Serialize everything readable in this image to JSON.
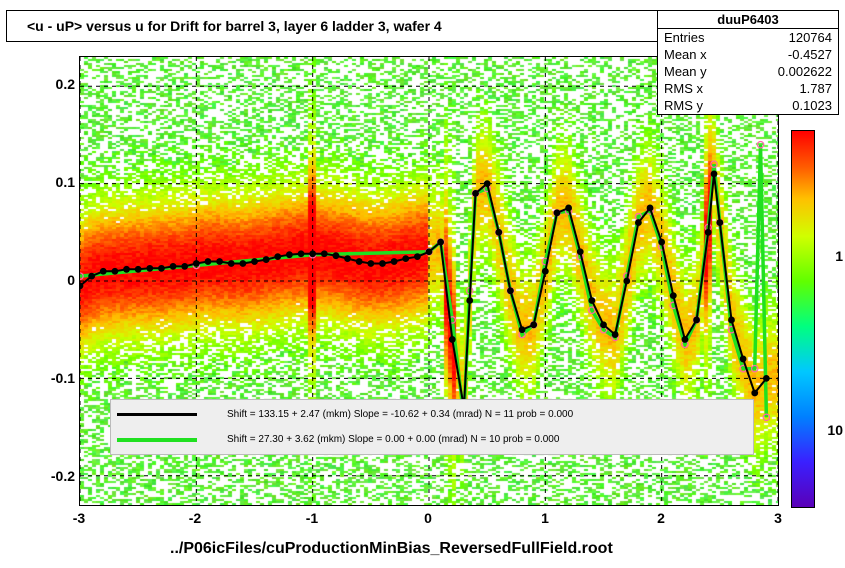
{
  "title": "<u - uP>       versus    u for Drift for barrel 3, layer 6 ladder 3, wafer 4",
  "stats": {
    "name": "duuP6403",
    "entries_label": "Entries",
    "entries": "120764",
    "meanx_label": "Mean x",
    "meanx": "-0.4527",
    "meany_label": "Mean y",
    "meany": "0.002622",
    "rmsx_label": "RMS x",
    "rmsx": "1.787",
    "rmsy_label": "RMS y",
    "rmsy": "0.1023"
  },
  "axes": {
    "x_ticks": [
      "-3",
      "-2",
      "-1",
      "0",
      "1",
      "2",
      "3"
    ],
    "y_ticks": [
      "-0.2",
      "-0.1",
      "0",
      "0.1",
      "0.2"
    ],
    "xlim": [
      -3,
      3
    ],
    "ylim": [
      -0.23,
      0.23
    ]
  },
  "colorbar": {
    "ticks": [
      "10",
      "1"
    ],
    "tick_positions": [
      0.88,
      0.35
    ]
  },
  "legend": {
    "fit1": "Shift =   133.15 +  2.47 (mkm) Slope =   -10.62 +  0.34 (mrad)  N = 11 prob = 0.000",
    "fit2": "Shift =    27.30 +  3.62 (mkm) Slope =     0.00 +  0.00 (mrad)  N = 10 prob = 0.000"
  },
  "caption": "../P06icFiles/cuProductionMinBias_ReversedFullField.root",
  "chart_data": {
    "type": "heatmap",
    "title": "<u - uP> versus u for Drift for barrel 3, layer 6 ladder 3, wafer 4",
    "xlabel": "u",
    "ylabel": "<u - uP>",
    "xlim": [
      -3,
      3
    ],
    "ylim": [
      -0.23,
      0.23
    ],
    "zscale": "log",
    "series": [
      {
        "name": "black profile (fit 1)",
        "type": "line+marker",
        "color": "#000000",
        "x": [
          -3.0,
          -2.9,
          -2.8,
          -2.7,
          -2.6,
          -2.5,
          -2.4,
          -2.3,
          -2.2,
          -2.1,
          -2.0,
          -1.9,
          -1.8,
          -1.7,
          -1.6,
          -1.5,
          -1.4,
          -1.3,
          -1.2,
          -1.1,
          -1.0,
          -0.9,
          -0.8,
          -0.7,
          -0.6,
          -0.5,
          -0.4,
          -0.3,
          -0.2,
          -0.1,
          0.0,
          0.1,
          0.2,
          0.3,
          0.35,
          0.4,
          0.5,
          0.6,
          0.7,
          0.8,
          0.9,
          1.0,
          1.1,
          1.2,
          1.3,
          1.4,
          1.5,
          1.6,
          1.7,
          1.8,
          1.9,
          2.0,
          2.1,
          2.2,
          2.3,
          2.4,
          2.45,
          2.5,
          2.6,
          2.7,
          2.8,
          2.9
        ],
        "y": [
          -0.005,
          0.005,
          0.01,
          0.01,
          0.012,
          0.012,
          0.013,
          0.013,
          0.015,
          0.015,
          0.018,
          0.02,
          0.02,
          0.018,
          0.018,
          0.02,
          0.022,
          0.025,
          0.027,
          0.028,
          0.028,
          0.028,
          0.026,
          0.023,
          0.02,
          0.018,
          0.018,
          0.02,
          0.023,
          0.025,
          0.03,
          0.04,
          -0.06,
          -0.13,
          -0.02,
          0.09,
          0.1,
          0.05,
          -0.01,
          -0.05,
          -0.045,
          0.01,
          0.07,
          0.075,
          0.03,
          -0.02,
          -0.045,
          -0.055,
          0.0,
          0.06,
          0.075,
          0.04,
          -0.015,
          -0.06,
          -0.04,
          0.05,
          0.11,
          0.06,
          -0.04,
          -0.08,
          -0.115,
          -0.1
        ]
      },
      {
        "name": "green fit (fit 2)",
        "type": "line",
        "color": "#20e020",
        "x": [
          -3.0,
          -2.0,
          -1.0,
          0.0,
          0.1,
          0.2,
          0.3,
          0.35,
          0.4,
          0.5,
          0.6,
          0.7,
          0.8,
          0.9,
          1.0,
          1.1,
          1.2,
          1.3,
          1.4,
          1.5,
          1.6,
          1.7,
          1.8,
          1.9,
          2.0,
          2.1,
          2.2,
          2.3,
          2.4,
          2.45,
          2.5,
          2.6,
          2.7,
          2.8,
          2.85,
          2.9
        ],
        "y": [
          0.005,
          0.016,
          0.027,
          0.03,
          0.04,
          -0.04,
          -0.14,
          -0.01,
          0.09,
          0.095,
          0.05,
          -0.01,
          -0.055,
          -0.045,
          0.02,
          0.07,
          0.072,
          0.025,
          -0.03,
          -0.05,
          -0.058,
          0.005,
          0.066,
          0.072,
          0.035,
          -0.025,
          -0.065,
          -0.04,
          0.055,
          0.12,
          0.06,
          -0.05,
          -0.09,
          -0.09,
          0.14,
          -0.14
        ]
      }
    ],
    "fit_parameters": [
      {
        "shift_mkm": 133.15,
        "shift_err": 2.47,
        "slope_mrad": -10.62,
        "slope_err": 0.34,
        "N": 11,
        "prob": 0.0
      },
      {
        "shift_mkm": 27.3,
        "shift_err": 3.62,
        "slope_mrad": 0.0,
        "slope_err": 0.0,
        "N": 10,
        "prob": 0.0
      }
    ]
  }
}
